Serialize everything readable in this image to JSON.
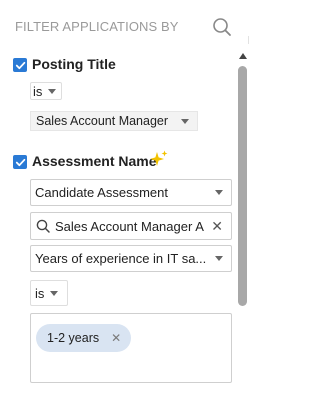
{
  "header": {
    "title": "FILTER APPLICATIONS BY"
  },
  "filters": [
    {
      "label": "Posting Title",
      "checked": true,
      "operator": "is",
      "value": "Sales Account Manager"
    },
    {
      "label": "Assessment Name",
      "checked": true,
      "assessment_select": "Candidate Assessment",
      "search_value": "Sales Account Manager  A",
      "question_select": "Years of experience in IT sa...",
      "operator": "is",
      "selected_tags": [
        "1-2 years"
      ]
    }
  ],
  "colors": {
    "checkbox": "#2a7ad5",
    "tag_bg": "#d9e4f2",
    "sparkle": "#f2c200"
  }
}
